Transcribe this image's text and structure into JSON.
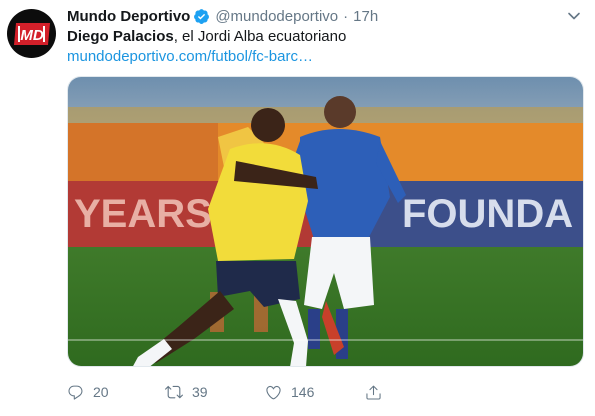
{
  "tweet": {
    "author_name": "Mundo Deportivo",
    "author_handle": "@mundodeportivo",
    "separator": "·",
    "time": "17h",
    "avatar_logo_text": "MD",
    "text_bold": "Diego Palacios",
    "text_rest": ", el Jordi Alba ecuatoriano",
    "link": "mundodeportivo.com/futbol/fc-barc…",
    "image_banner_text": [
      "YEARS",
      "FOUNDA"
    ],
    "counts": {
      "replies": "20",
      "retweets": "39",
      "likes": "146"
    }
  },
  "colors": {
    "link": "#1b95e0",
    "verified": "#1da1f2",
    "muted": "#657786",
    "avatar_bg": "#0c0c0c",
    "logo_red": "#d3202a"
  },
  "icons": [
    "verified-badge-icon",
    "chevron-down-icon",
    "reply-icon",
    "retweet-icon",
    "like-icon",
    "share-icon"
  ]
}
